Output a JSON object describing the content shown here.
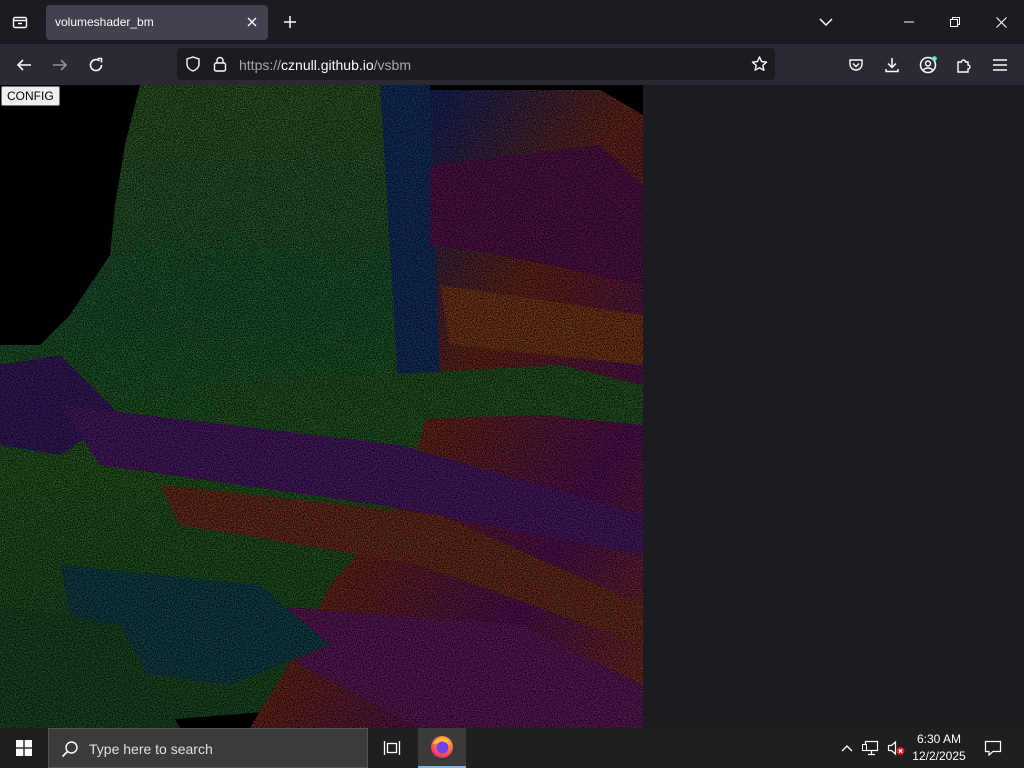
{
  "browser": {
    "tab": {
      "title": "volumeshader_bm"
    },
    "url": {
      "scheme": "https://",
      "host": "cznull.github.io",
      "path": "/vsbm"
    }
  },
  "page": {
    "config_label": "CONFIG"
  },
  "taskbar": {
    "search_placeholder": "Type here to search",
    "time": "6:30 AM",
    "date": "12/2/2025"
  },
  "icons": {
    "tab_list": "tab-list-icon",
    "close": "close-icon",
    "new_tab": "plus-icon",
    "back": "back-arrow-icon",
    "forward": "forward-arrow-icon",
    "reload": "reload-icon",
    "shield": "tracking-shield-icon",
    "lock": "lock-icon",
    "star": "bookmark-star-icon",
    "pocket": "pocket-icon",
    "downloads": "download-icon",
    "account": "account-icon",
    "extensions": "extensions-icon",
    "menu": "hamburger-menu-icon"
  },
  "colors": {
    "chrome_dark": "#1c1b22",
    "toolbar": "#2b2a33",
    "tab_active": "#42414d",
    "canvas_bg": "#000000"
  }
}
